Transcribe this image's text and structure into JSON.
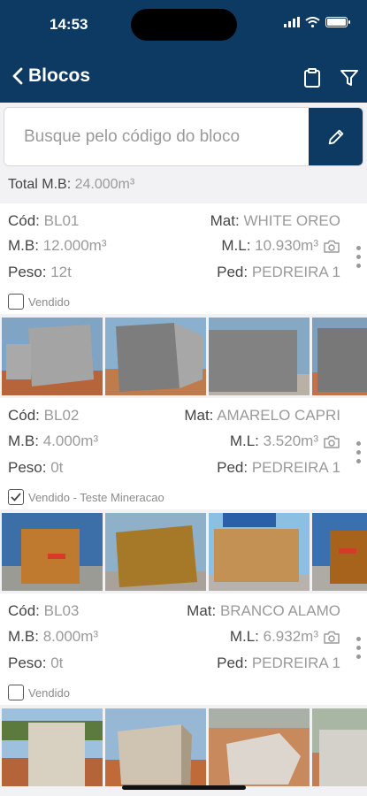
{
  "status": {
    "time": "14:53"
  },
  "header": {
    "back_label": "Blocos"
  },
  "search": {
    "placeholder": "Busque pelo código do bloco",
    "value": ""
  },
  "total": {
    "label": "Total M.B:",
    "value": "24.000m³"
  },
  "labels": {
    "cod": "Cód:",
    "mat": "Mat:",
    "mb": "M.B:",
    "ml": "M.L:",
    "peso": "Peso:",
    "ped": "Ped:"
  },
  "blocks": [
    {
      "cod": "BL01",
      "mat": "WHITE OREO",
      "mb": "12.000m³",
      "ml": "10.930m³",
      "peso": "12t",
      "ped": "PEDREIRA 1",
      "vendido_label": "Vendido",
      "vendido": false
    },
    {
      "cod": "BL02",
      "mat": "AMARELO CAPRI",
      "mb": "4.000m³",
      "ml": "3.520m³",
      "peso": "0t",
      "ped": "PEDREIRA 1",
      "vendido_label": "Vendido - Teste Mineracao",
      "vendido": true
    },
    {
      "cod": "BL03",
      "mat": "BRANCO ALAMO",
      "mb": "8.000m³",
      "ml": "6.932m³",
      "peso": "0t",
      "ped": "PEDREIRA 1",
      "vendido_label": "Vendido",
      "vendido": false
    }
  ],
  "colors": {
    "brand": "#0d3a63",
    "muted": "#9a9a9a"
  },
  "icons": [
    "chevron-left-icon",
    "clipboard-icon",
    "filter-icon",
    "pencil-icon",
    "camera-icon",
    "kebab-menu-icon",
    "checkbox-icon",
    "wifi-icon",
    "signal-icon",
    "battery-icon"
  ]
}
